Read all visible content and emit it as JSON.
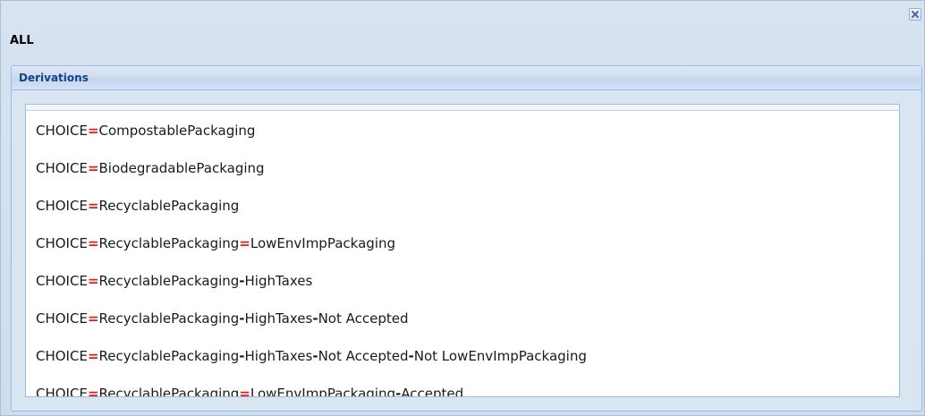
{
  "window": {
    "title": "ALL",
    "close_icon": "close-icon"
  },
  "panel": {
    "title": "Derivations"
  },
  "derivations": [
    [
      {
        "t": "CHOICE",
        "k": "text"
      },
      {
        "t": "=",
        "k": "eq"
      },
      {
        "t": "CompostablePackaging",
        "k": "text"
      }
    ],
    [
      {
        "t": "CHOICE",
        "k": "text"
      },
      {
        "t": "=",
        "k": "eq"
      },
      {
        "t": "BiodegradablePackaging",
        "k": "text"
      }
    ],
    [
      {
        "t": "CHOICE",
        "k": "text"
      },
      {
        "t": "=",
        "k": "eq"
      },
      {
        "t": "RecyclablePackaging",
        "k": "text"
      }
    ],
    [
      {
        "t": "CHOICE",
        "k": "text"
      },
      {
        "t": "=",
        "k": "eq"
      },
      {
        "t": "RecyclablePackaging",
        "k": "text"
      },
      {
        "t": "=",
        "k": "eq"
      },
      {
        "t": "LowEnvImpPackaging",
        "k": "text"
      }
    ],
    [
      {
        "t": "CHOICE",
        "k": "text"
      },
      {
        "t": "=",
        "k": "eq"
      },
      {
        "t": "RecyclablePackaging",
        "k": "text"
      },
      {
        "t": "-",
        "k": "dash"
      },
      {
        "t": "HighTaxes",
        "k": "text"
      }
    ],
    [
      {
        "t": "CHOICE",
        "k": "text"
      },
      {
        "t": "=",
        "k": "eq"
      },
      {
        "t": "RecyclablePackaging",
        "k": "text"
      },
      {
        "t": "-",
        "k": "dash"
      },
      {
        "t": "HighTaxes",
        "k": "text"
      },
      {
        "t": "-",
        "k": "dash"
      },
      {
        "t": "Not Accepted",
        "k": "text"
      }
    ],
    [
      {
        "t": "CHOICE",
        "k": "text"
      },
      {
        "t": "=",
        "k": "eq"
      },
      {
        "t": "RecyclablePackaging",
        "k": "text"
      },
      {
        "t": "-",
        "k": "dash"
      },
      {
        "t": "HighTaxes",
        "k": "text"
      },
      {
        "t": "-",
        "k": "dash"
      },
      {
        "t": "Not Accepted",
        "k": "text"
      },
      {
        "t": "-",
        "k": "dash"
      },
      {
        "t": "Not LowEnvImpPackaging",
        "k": "text"
      }
    ],
    [
      {
        "t": "CHOICE",
        "k": "text"
      },
      {
        "t": "=",
        "k": "eq"
      },
      {
        "t": "RecyclablePackaging",
        "k": "text"
      },
      {
        "t": "=",
        "k": "eq"
      },
      {
        "t": "LowEnvImpPackaging",
        "k": "text"
      },
      {
        "t": "-",
        "k": "dash"
      },
      {
        "t": "Accepted",
        "k": "text"
      }
    ]
  ],
  "colors": {
    "operator": "#e21c1c",
    "panel_title": "#15428b"
  }
}
